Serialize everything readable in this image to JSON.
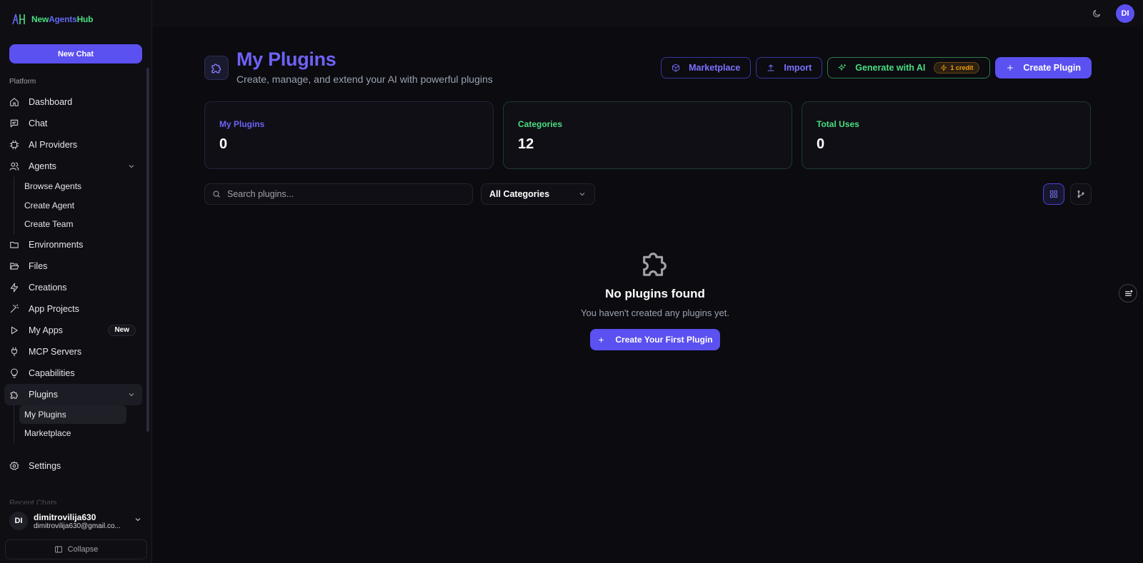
{
  "brand": {
    "part1": "New",
    "part2": "Agents",
    "part3": "Hub"
  },
  "sidebar": {
    "new_chat": "New Chat",
    "section_label": "Platform",
    "items": [
      {
        "label": "Dashboard",
        "icon": "home-icon"
      },
      {
        "label": "Chat",
        "icon": "message-icon"
      },
      {
        "label": "AI Providers",
        "icon": "cpu-icon"
      },
      {
        "label": "Agents",
        "icon": "users-icon"
      },
      {
        "label": "Environments",
        "icon": "folder-icon"
      },
      {
        "label": "Files",
        "icon": "folder-open-icon"
      },
      {
        "label": "Creations",
        "icon": "zap-icon"
      },
      {
        "label": "App Projects",
        "icon": "wand-icon"
      },
      {
        "label": "My Apps",
        "icon": "play-icon",
        "badge": "New"
      },
      {
        "label": "MCP Servers",
        "icon": "plug-icon"
      },
      {
        "label": "Capabilities",
        "icon": "lightbulb-icon"
      },
      {
        "label": "Plugins",
        "icon": "puzzle-icon"
      },
      {
        "label": "Settings",
        "icon": "gear-icon"
      }
    ],
    "agents_sub": [
      "Browse Agents",
      "Create Agent",
      "Create Team"
    ],
    "plugins_sub": [
      "My Plugins",
      "Marketplace"
    ],
    "recent_label": "Recent Chats",
    "user": {
      "initials": "DI",
      "name": "dimitrovilija630",
      "email": "dimitrovilija630@gmail.co..."
    },
    "collapse": "Collapse"
  },
  "topbar": {
    "avatar": "DI"
  },
  "header": {
    "title": "My Plugins",
    "subtitle": "Create, manage, and extend your AI with powerful plugins",
    "actions": {
      "marketplace": "Marketplace",
      "import": "Import",
      "generate": "Generate with AI",
      "credit": "1 credit",
      "create": "Create Plugin"
    }
  },
  "stats": [
    {
      "label": "My Plugins",
      "value": "0"
    },
    {
      "label": "Categories",
      "value": "12"
    },
    {
      "label": "Total Uses",
      "value": "0"
    }
  ],
  "filters": {
    "search_placeholder": "Search plugins...",
    "category": "All Categories"
  },
  "empty": {
    "title": "No plugins found",
    "subtitle": "You haven't created any plugins yet.",
    "button": "Create Your First Plugin"
  },
  "colors": {
    "accent": "#5b50f0",
    "green": "#4ade80",
    "amber": "#f59e0b",
    "background": "#0b0b10"
  }
}
